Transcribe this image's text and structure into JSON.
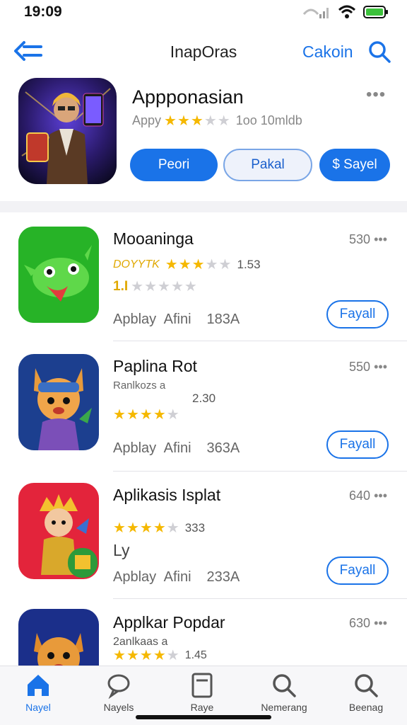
{
  "status": {
    "time": "19:09"
  },
  "nav": {
    "title": "InapOras",
    "action": "Cakoin"
  },
  "hero": {
    "title": "Appponasian",
    "subtitle_prefix": "Appy",
    "rating_stars": 3,
    "subtitle_suffix": "1oo 10mldb",
    "buttons": [
      "Peori",
      "Pakal",
      "$ Sayel"
    ]
  },
  "apps": [
    {
      "name": "Mooaninga",
      "size": "530",
      "line1_text": "DOYYTK",
      "line1_stars": 3,
      "line1_value": "1.53",
      "line2_text": "1.I",
      "line2_stars": 0,
      "meta": "Apblay Afini",
      "count": "183A",
      "button": "Fayall",
      "icon": "frog-icon"
    },
    {
      "name": "Paplina Rot",
      "size": "550",
      "line1_text": "Ranlkozs a",
      "line1_value": "2.30",
      "line2_stars": 4,
      "meta": "Apblay Afini",
      "count": "363A",
      "button": "Fayall",
      "icon": "fox-character-icon"
    },
    {
      "name": "Aplikasis Isplat",
      "size": "640",
      "line1_stars": 4,
      "line1_value": "333",
      "line2_text": "Ly",
      "meta": "Apblay Afini",
      "count": "233A",
      "button": "Fayall",
      "icon": "warrior-character-icon"
    },
    {
      "name": "Applkar Popdar",
      "size": "630",
      "line1_text": "2anlkaas a",
      "line1_stars": 4,
      "line1_value": "1.45",
      "icon": "cat-character-icon"
    }
  ],
  "tabs": [
    {
      "label": "Nayel",
      "icon": "home-icon",
      "active": true
    },
    {
      "label": "Nayels",
      "icon": "chat-icon"
    },
    {
      "label": "Raye",
      "icon": "document-icon"
    },
    {
      "label": "Nemerang",
      "icon": "search-icon"
    },
    {
      "label": "Beenag",
      "icon": "search-icon"
    }
  ],
  "colors": {
    "accent": "#1a73e8",
    "star": "#f5b800"
  }
}
